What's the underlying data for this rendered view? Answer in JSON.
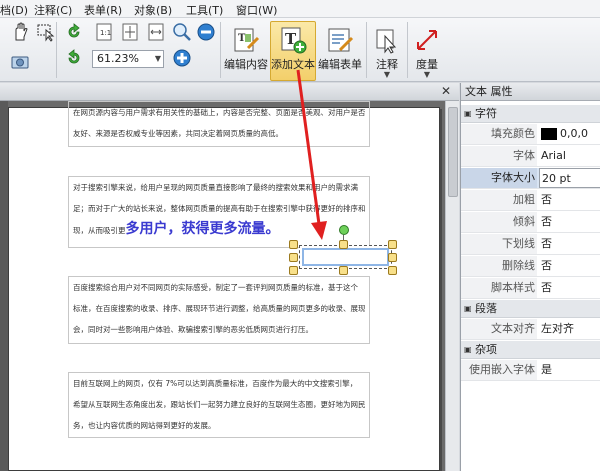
{
  "menu": {
    "items": [
      "档(D)",
      "注释(C)",
      "表单(R)",
      "对象(B)",
      "工具(T)",
      "窗口(W)"
    ]
  },
  "toolbar": {
    "zoom": "61.23%",
    "edit_content": "编辑内容",
    "add_text": "添加文本",
    "edit_form": "编辑表单",
    "annotate": "注释",
    "measure": "度量"
  },
  "document": {
    "paragraphs": [
      [
        "在网页源内容与用户需求有用关性的基础上，内容是否完整、页面是否美观、对用户是否",
        "友好、来源是否权威专业等因素，共同决定着网页质量的高低。"
      ],
      [
        "对于搜索引擎来说，给用户呈现的网页质量直接影响了最终的搜索效果和用户的需求满",
        "足；而对于广大的站长来说，整体网页质量的提高有助于在搜索引擎中获得更好的排序和展",
        "现，从而吸引更"
      ],
      [
        "百度搜索综合用户对不同网页的实际感受，制定了一套评判网页质量的标准，基于这个",
        "标准，在百度搜索的收录、排序、展现环节进行调整，给高质量的网页更多的收录、展现机",
        "会，同时对一些影响用户体验、欺骗搜索引擎的恶劣低质网页进行打压。"
      ],
      [
        "目前互联网上的网页，仅有 7%可以达到高质量标准，百度作为最大的中文搜索引擎，",
        "希望从互联网生态角度出发，跟站长们一起努力建立良好的互联网生态圈，更好地为网民服",
        "务，也让内容优质的网站得到更好的发展。"
      ]
    ],
    "highlight": "多用户，获得更多流量。"
  },
  "props": {
    "title": "文本 属性",
    "sections": {
      "char": "字符",
      "para": "段落",
      "misc": "杂项"
    },
    "rows": {
      "fill_k": "填充颜色",
      "fill_v": "0,0,0",
      "font_k": "字体",
      "font_v": "Arial",
      "size_k": "字体大小",
      "size_v": "20 pt",
      "bold_k": "加粗",
      "bold_v": "否",
      "italic_k": "倾斜",
      "italic_v": "否",
      "under_k": "下划线",
      "under_v": "否",
      "strike_k": "删除线",
      "strike_v": "否",
      "script_k": "脚本样式",
      "script_v": "否",
      "align_k": "文本对齐",
      "align_v": "左对齐",
      "embed_k": "使用嵌入字体",
      "embed_v": "是"
    }
  },
  "colors": {
    "accent": "#f3cf6a",
    "arrow": "#e02020",
    "highlight_text": "#3a3ad0"
  }
}
